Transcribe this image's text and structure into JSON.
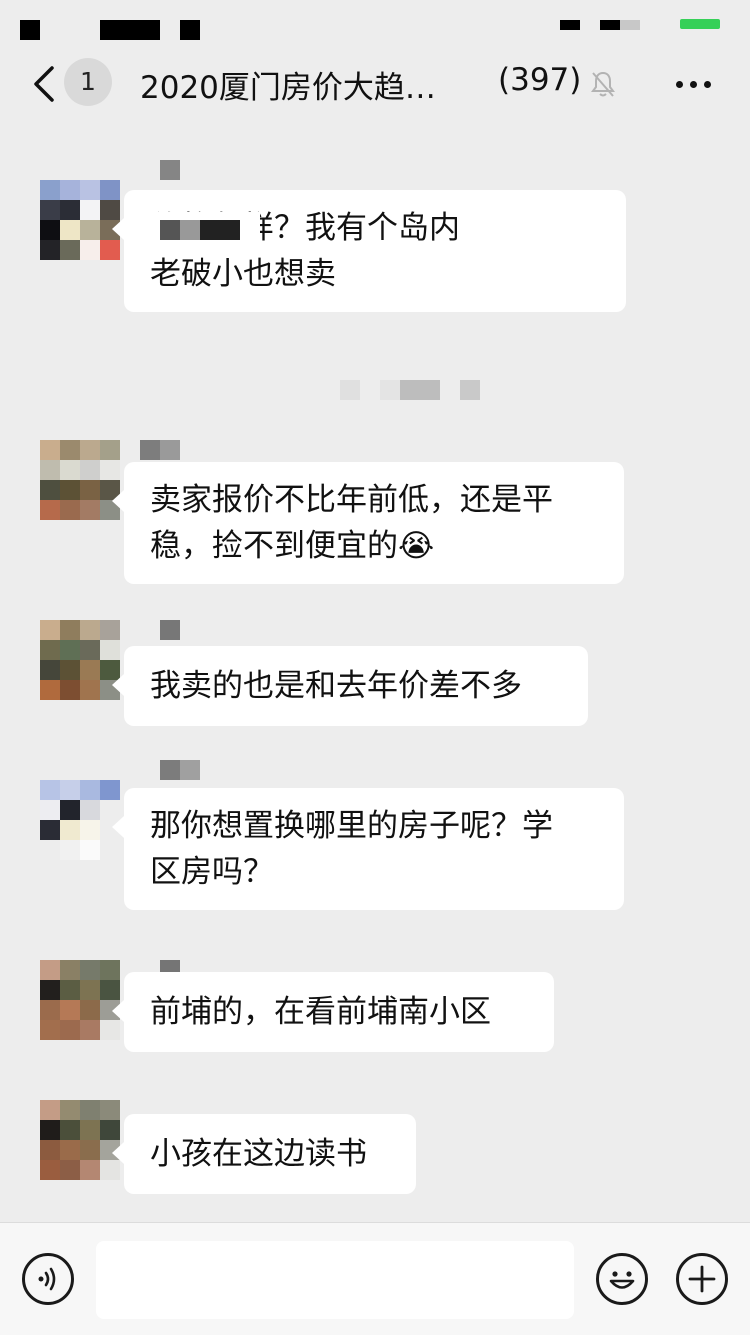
{
  "status_bar": {
    "accent": "#36d058"
  },
  "header": {
    "back_icon": "chevron-left-icon",
    "unread_badge": "1",
    "title": "2020厦门房价大趋…",
    "member_count": "(397)",
    "mute_icon": "bell-muted-icon",
    "more_icon": "more-dots-icon"
  },
  "messages": [
    {
      "text": "价格怎样？我有个岛内\n老破小也想卖",
      "note": "partially obscured"
    },
    {
      "text": "卖家报价不比年前低，还是平\n稳，捡不到便宜的😭"
    },
    {
      "text": "我卖的也是和去年价差不多"
    },
    {
      "text": "那你想置换哪里的房子呢？学\n区房吗？"
    },
    {
      "text": "前埔的，在看前埔南小区"
    },
    {
      "text": "小孩在这边读书"
    }
  ],
  "input_bar": {
    "voice_icon": "voice-icon",
    "emoji_icon": "emoji-icon",
    "plus_icon": "plus-icon",
    "input_value": ""
  },
  "colors": {
    "background": "#ededed",
    "bubble": "#ffffff",
    "battery": "#36d058"
  }
}
